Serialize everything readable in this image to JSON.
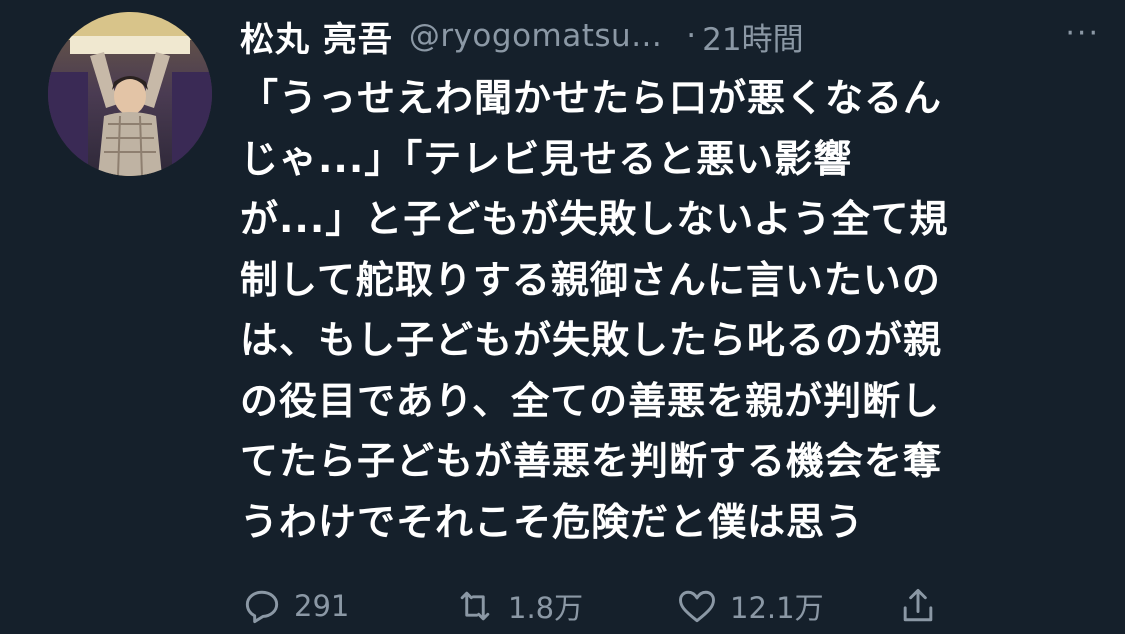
{
  "tweet": {
    "author_name": "松丸 亮吾",
    "handle": "@ryogomatsu...",
    "separator": "·",
    "time": "21時間",
    "more_icon": "more-horizontal-icon",
    "more_label": "···",
    "text_lines": [
      "「うっせえわ聞かせたら口が悪くなるん",
      "じゃ...」「テレビ見せると悪い影響",
      "が...」と子どもが失敗しないよう全て規",
      "制して舵取りする親御さんに言いたいの",
      "は、もし子どもが失敗したら叱るのが親",
      "の役目であり、全ての善悪を親が判断し",
      "てたら子どもが善悪を判断する機会を奪",
      "うわけでそれこそ危険だと僕は思う"
    ],
    "actions": {
      "reply": {
        "icon": "reply-icon",
        "count": "291"
      },
      "retweet": {
        "icon": "retweet-icon",
        "count": "1.8万"
      },
      "like": {
        "icon": "heart-icon",
        "count": "12.1万"
      },
      "share": {
        "icon": "share-icon"
      }
    }
  }
}
